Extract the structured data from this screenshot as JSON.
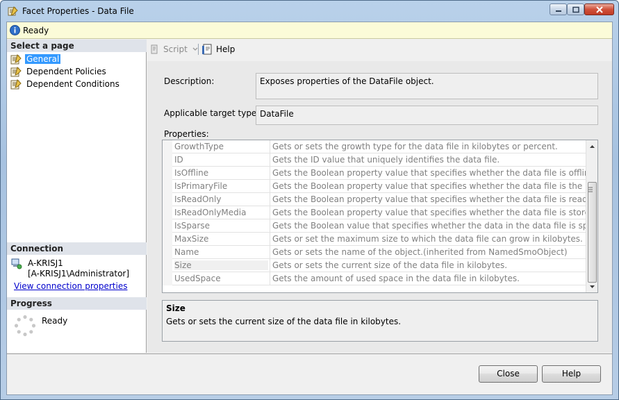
{
  "window": {
    "title": "Facet Properties - Data File"
  },
  "status": {
    "text": "Ready"
  },
  "left_pane": {
    "select_page_header": "Select a page",
    "pages": [
      {
        "label": "General",
        "selected": true
      },
      {
        "label": "Dependent Policies",
        "selected": false
      },
      {
        "label": "Dependent Conditions",
        "selected": false
      }
    ],
    "connection_header": "Connection",
    "server": "A-KRISJ1",
    "user": "[A-KRISJ1\\Administrator]",
    "view_connection_link": "View connection properties",
    "progress_header": "Progress",
    "progress_status": "Ready"
  },
  "toolbar": {
    "script_label": "Script",
    "help_label": "Help"
  },
  "form": {
    "description_label": "Description:",
    "description_value": "Exposes properties of the DataFile object.",
    "target_types_label": "Applicable target types:",
    "target_types_value": "DataFile",
    "properties_label": "Properties:"
  },
  "properties": {
    "rows": [
      {
        "name": "GrowthType",
        "desc": "Gets or sets the growth type for the data file in kilobytes or percent."
      },
      {
        "name": "ID",
        "desc": "Gets the ID value that uniquely identifies the data file."
      },
      {
        "name": "IsOffline",
        "desc": "Gets the Boolean property value that specifies whether the data file is offline or not."
      },
      {
        "name": "IsPrimaryFile",
        "desc": "Gets the Boolean property value that specifies whether the data file is the primary file o"
      },
      {
        "name": "IsReadOnly",
        "desc": "Gets the Boolean property value that specifies whether the data file is read-only or can"
      },
      {
        "name": "IsReadOnlyMedia",
        "desc": "Gets the Boolean property value that specifies whether the data file is stored on read-o"
      },
      {
        "name": "IsSparse",
        "desc": "Gets the Boolean value that specifies whether the data in the data file is sparse or dens"
      },
      {
        "name": "MaxSize",
        "desc": "Gets or set the maximum size to which the data file can grow in kilobytes."
      },
      {
        "name": "Name",
        "desc": "Gets or sets the name of the object.(inherited from NamedSmoObject)"
      },
      {
        "name": "Size",
        "desc": "Gets or sets the current size of the data file in kilobytes."
      },
      {
        "name": "UsedSpace",
        "desc": "Gets the amount of used space in the data file in kilobytes."
      }
    ]
  },
  "help_panel": {
    "title": "Size",
    "description": "Gets or sets the current size of the data file in kilobytes."
  },
  "buttons": {
    "close_label": "Close",
    "help_label": "Help"
  },
  "colors": {
    "selection": "#3399ff",
    "status_bar": "#fbfbd8",
    "section_header": "#dfe3ea",
    "link": "#0000cc"
  }
}
